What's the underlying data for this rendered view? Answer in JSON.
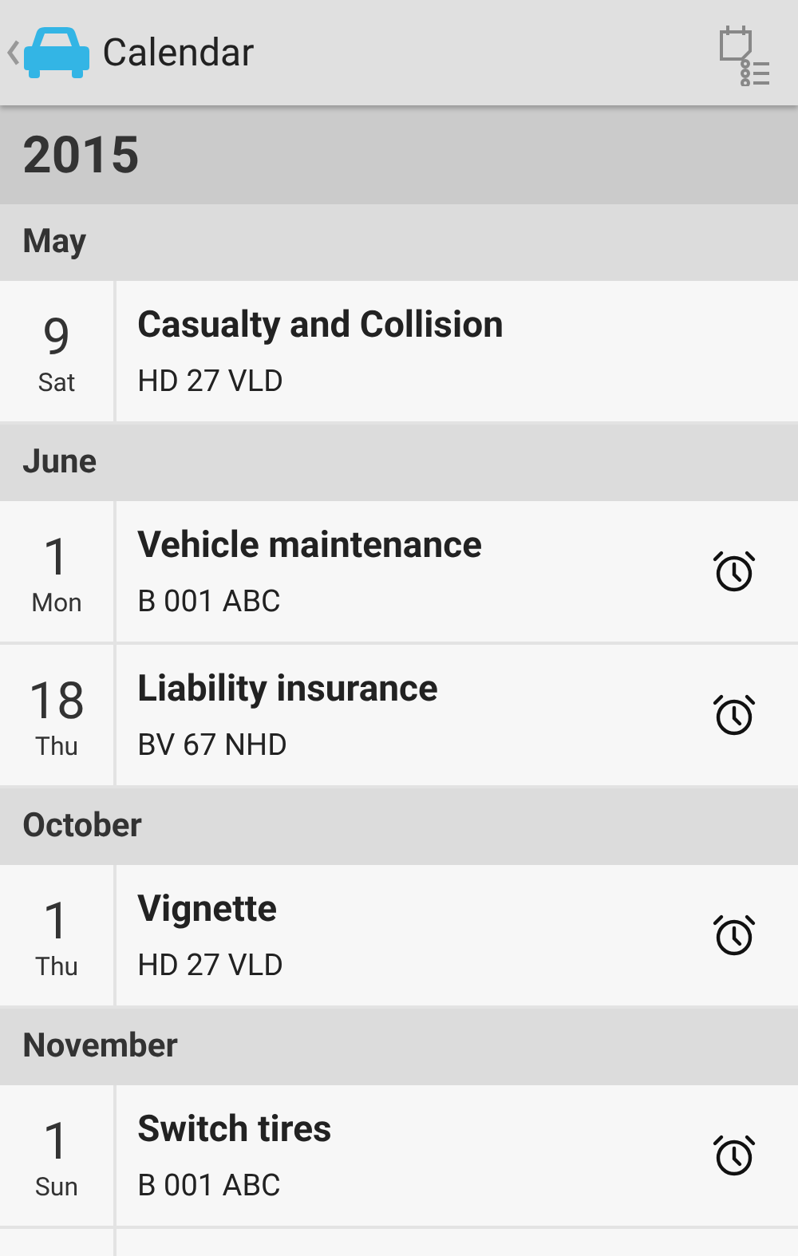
{
  "app_bar": {
    "title": "Calendar"
  },
  "year": "2015",
  "months": [
    {
      "name": "May",
      "events": [
        {
          "day": "9",
          "weekday": "Sat",
          "title": "Casualty and Collision",
          "plate": "HD 27 VLD",
          "alarm": false
        }
      ]
    },
    {
      "name": "June",
      "events": [
        {
          "day": "1",
          "weekday": "Mon",
          "title": "Vehicle maintenance",
          "plate": "B 001 ABC",
          "alarm": true
        },
        {
          "day": "18",
          "weekday": "Thu",
          "title": "Liability insurance",
          "plate": "BV 67 NHD",
          "alarm": true
        }
      ]
    },
    {
      "name": "October",
      "events": [
        {
          "day": "1",
          "weekday": "Thu",
          "title": "Vignette",
          "plate": "HD 27 VLD",
          "alarm": true
        }
      ]
    },
    {
      "name": "November",
      "events": [
        {
          "day": "1",
          "weekday": "Sun",
          "title": "Switch tires",
          "plate": "B 001 ABC",
          "alarm": true
        }
      ]
    }
  ]
}
